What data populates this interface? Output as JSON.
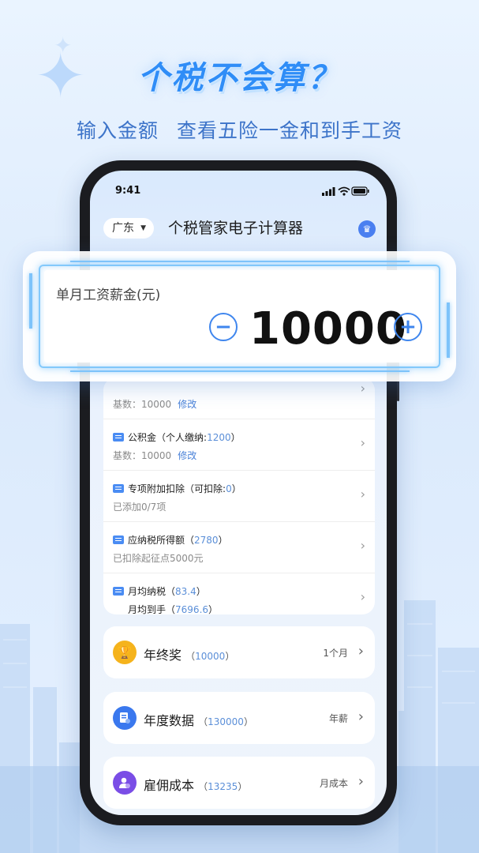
{
  "promo": {
    "headline": "个税不会算？",
    "subline": "输入金额  查看五险一金和到手工资"
  },
  "status_bar": {
    "time": "9:41"
  },
  "header": {
    "region": "广东",
    "title": "个税管家电子计算器"
  },
  "salary_input": {
    "label": "单月工资薪金(元)",
    "value": "10000",
    "minus": "−",
    "plus": "+"
  },
  "details": {
    "partial_row": {
      "prefix": "基数：",
      "value": "10000",
      "edit": "修改"
    },
    "rows": [
      {
        "name": "公积金",
        "paren_open": "（个人缴纳:",
        "value": "1200",
        "paren_close": "）",
        "sub_prefix": "基数：",
        "sub_value": "10000",
        "sub_edit": "修改"
      },
      {
        "name": "专项附加扣除",
        "paren_open": "（可扣除:",
        "value": "0",
        "paren_close": "）",
        "sub_text": "已添加0/7项"
      },
      {
        "name": "应纳税所得额",
        "paren_open": "（",
        "value": "2780",
        "paren_close": "）",
        "sub_text": "已扣除起征点5000元"
      },
      {
        "name": "月均纳税",
        "paren_open": "（",
        "value": "83.4",
        "paren_close": "）",
        "sub_name": "月均到手",
        "sub_paren_open": "（",
        "sub_value": "7696.6",
        "sub_paren_close": "）"
      }
    ]
  },
  "summary": [
    {
      "label": "年终奖",
      "value": "10000",
      "right": "1个月",
      "icon": "trophy-icon",
      "color": "#f5b31c"
    },
    {
      "label": "年度数据",
      "value": "130000",
      "right": "年薪",
      "icon": "document-icon",
      "color": "#3a78ee"
    },
    {
      "label": "雇佣成本",
      "value": "13235",
      "right": "月成本",
      "icon": "employee-icon",
      "color": "#7a4de6"
    }
  ],
  "glyphs": {
    "chevron": "›",
    "caret": "▼",
    "paren_open": "（",
    "paren_close": "）"
  }
}
